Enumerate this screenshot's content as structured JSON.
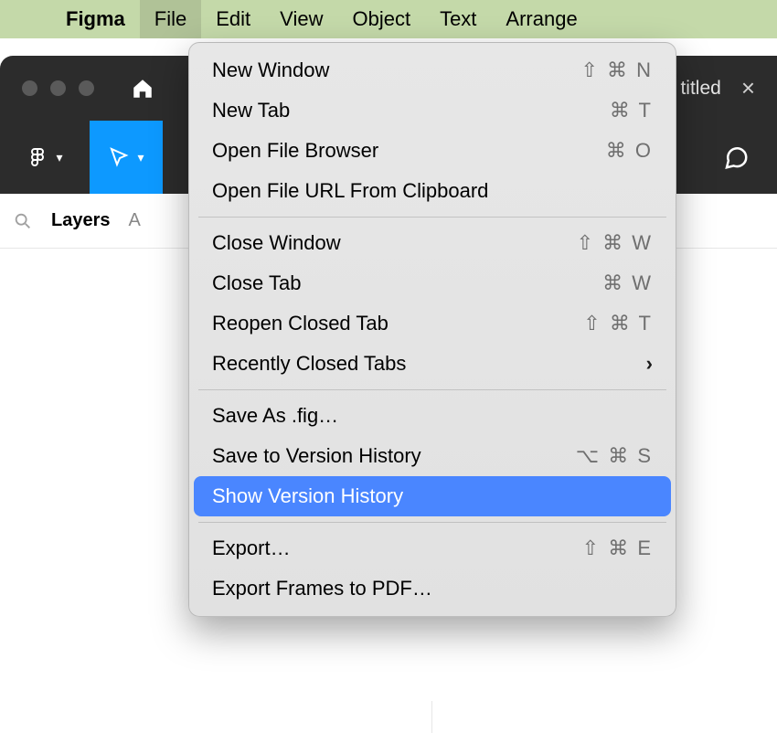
{
  "menubar": {
    "app_name": "Figma",
    "items": [
      "File",
      "Edit",
      "View",
      "Object",
      "Text",
      "Arrange"
    ],
    "open_index": 0
  },
  "window": {
    "tab_title_suffix": "titled",
    "close_glyph": "×"
  },
  "panel": {
    "layers_label": "Layers",
    "assets_first_letter": "A"
  },
  "dropdown": [
    {
      "label": "New Window",
      "shortcut": "⇧ ⌘ N"
    },
    {
      "label": "New Tab",
      "shortcut": "⌘ T"
    },
    {
      "label": "Open File Browser",
      "shortcut": "⌘ O"
    },
    {
      "label": "Open File URL From Clipboard",
      "shortcut": ""
    },
    {
      "sep": true
    },
    {
      "label": "Close Window",
      "shortcut": "⇧ ⌘ W"
    },
    {
      "label": "Close Tab",
      "shortcut": "⌘ W"
    },
    {
      "label": "Reopen Closed Tab",
      "shortcut": "⇧ ⌘ T"
    },
    {
      "label": "Recently Closed Tabs",
      "submenu": true
    },
    {
      "sep": true
    },
    {
      "label": "Save As .fig…",
      "shortcut": ""
    },
    {
      "label": "Save to Version History",
      "shortcut": "⌥ ⌘ S"
    },
    {
      "label": "Show Version History",
      "highlight": true
    },
    {
      "sep": true
    },
    {
      "label": "Export…",
      "shortcut": "⇧ ⌘ E"
    },
    {
      "label": "Export Frames to PDF…",
      "shortcut": ""
    }
  ]
}
